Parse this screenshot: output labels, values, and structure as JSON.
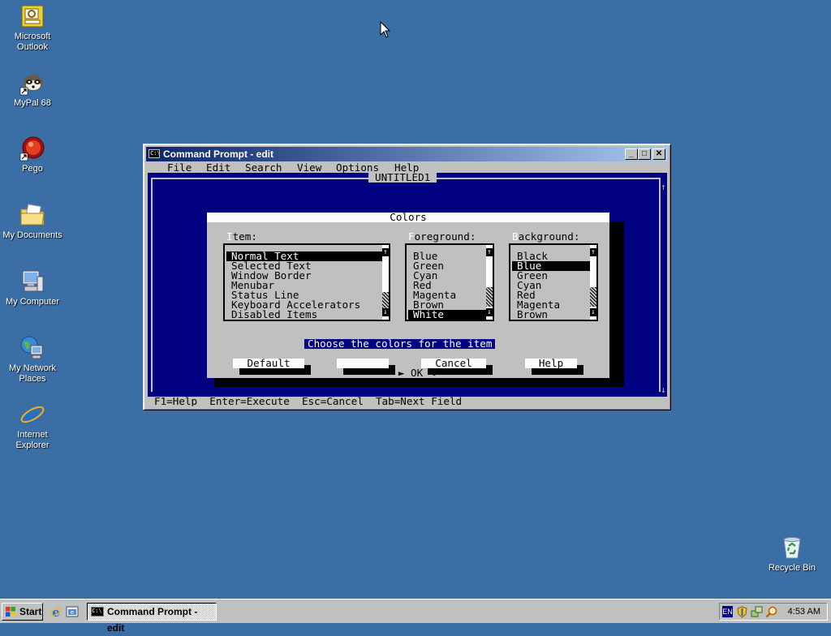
{
  "desktop": {
    "icons": [
      {
        "label": "Microsoft Outlook",
        "line1": "Microsoft",
        "line2": "Outlook",
        "icon": "outlook-icon"
      },
      {
        "label": "MyPal 68",
        "line1": "MyPal 68",
        "line2": "",
        "icon": "raccoon-icon"
      },
      {
        "label": "Pego",
        "line1": "Pego",
        "line2": "",
        "icon": "pego-icon"
      },
      {
        "label": "My Documents",
        "line1": "My Documents",
        "line2": "",
        "icon": "folder-documents-icon"
      },
      {
        "label": "My Computer",
        "line1": "My Computer",
        "line2": "",
        "icon": "computer-icon"
      },
      {
        "label": "My Network Places",
        "line1": "My Network",
        "line2": "Places",
        "icon": "network-places-icon"
      },
      {
        "label": "Internet Explorer",
        "line1": "Internet",
        "line2": "Explorer",
        "icon": "internet-explorer-icon"
      },
      {
        "label": "Recycle Bin",
        "line1": "Recycle Bin",
        "line2": "",
        "icon": "recycle-bin-icon"
      }
    ]
  },
  "window": {
    "title": "Command Prompt - edit",
    "icon_text": "C:\\",
    "minimize": "_",
    "maximize": "□",
    "close": "✕"
  },
  "edit": {
    "menus": [
      "File",
      "Edit",
      "Search",
      "View",
      "Options",
      "Help"
    ],
    "document_title": "UNTITLED1",
    "status_bar": "F1=Help  Enter=Execute  Esc=Cancel  Tab=Next Field"
  },
  "dialog": {
    "title": "Colors",
    "item_label_hot": "I",
    "item_label_rest": "tem:",
    "foreground_label_hot": "F",
    "foreground_label_rest": "oreground:",
    "background_label_hot": "B",
    "background_label_rest": "ackground:",
    "items": [
      "Normal Text",
      "Selected Text",
      "Window Border",
      "Menubar",
      "Status Line",
      "Keyboard Accelerators",
      "Disabled Items"
    ],
    "items_selected": "Normal Text",
    "foreground": [
      "Blue",
      "Green",
      "Cyan",
      "Red",
      "Magenta",
      "Brown",
      "White"
    ],
    "foreground_selected": "White",
    "background": [
      "Black",
      "Blue",
      "Green",
      "Cyan",
      "Red",
      "Magenta",
      "Brown"
    ],
    "background_selected": "Blue",
    "hint": "Choose the colors for the item",
    "buttons": {
      "default": "Default",
      "ok": "OK",
      "cancel": "Cancel",
      "help": "Help"
    },
    "ok_marker_left": "►",
    "ok_marker_right": "◄"
  },
  "taskbar": {
    "start_label": "Start",
    "task_label": "Command Prompt - edit",
    "language": "EN",
    "clock": "4:53 AM"
  },
  "colors": {
    "desktop": "#3a6ea5",
    "dos_blue": "#000080",
    "dos_gray": "#c0c0c0"
  }
}
